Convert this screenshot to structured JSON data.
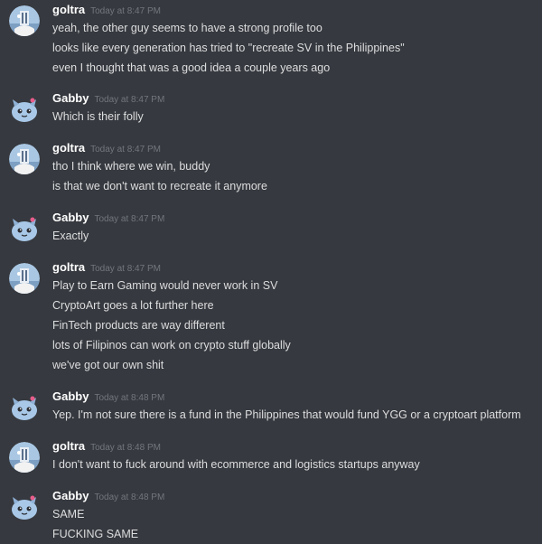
{
  "chat": {
    "messages": [
      {
        "author": "goltra",
        "avatar": "goltra-avatar-icon",
        "timestamp": "Today at 8:47 PM",
        "lines": [
          "yeah, the other guy seems to have a strong profile too",
          "looks like every generation has tried to \"recreate SV in the Philippines\"",
          "even I thought that was a good idea a couple years ago"
        ]
      },
      {
        "author": "Gabby",
        "avatar": "gabby-avatar-icon",
        "timestamp": "Today at 8:47 PM",
        "lines": [
          "Which is their folly"
        ]
      },
      {
        "author": "goltra",
        "avatar": "goltra-avatar-icon",
        "timestamp": "Today at 8:47 PM",
        "lines": [
          "tho I think where we win, buddy",
          "is that we don't want to recreate it anymore"
        ]
      },
      {
        "author": "Gabby",
        "avatar": "gabby-avatar-icon",
        "timestamp": "Today at 8:47 PM",
        "lines": [
          "Exactly"
        ]
      },
      {
        "author": "goltra",
        "avatar": "goltra-avatar-icon",
        "timestamp": "Today at 8:47 PM",
        "lines": [
          "Play to Earn Gaming would never work in SV",
          "CryptoArt goes a lot further here",
          "FinTech products are way different",
          "lots of Filipinos can work on crypto stuff globally",
          "we've got our own shit"
        ]
      },
      {
        "author": "Gabby",
        "avatar": "gabby-avatar-icon",
        "timestamp": "Today at 8:48 PM",
        "lines": [
          "Yep. I'm not sure there is a fund in the Philippines that would fund YGG or a cryptoart platform"
        ]
      },
      {
        "author": "goltra",
        "avatar": "goltra-avatar-icon",
        "timestamp": "Today at 8:48 PM",
        "lines": [
          "I don't want to fuck around with ecommerce and logistics startups anyway"
        ]
      },
      {
        "author": "Gabby",
        "avatar": "gabby-avatar-icon",
        "timestamp": "Today at 8:48 PM",
        "lines": [
          "SAME",
          "FUCKING SAME"
        ]
      }
    ]
  },
  "theme": {
    "background": "#36393f",
    "username_color": "#ffffff",
    "timestamp_color": "#72767d",
    "text_color": "#dcddde"
  }
}
